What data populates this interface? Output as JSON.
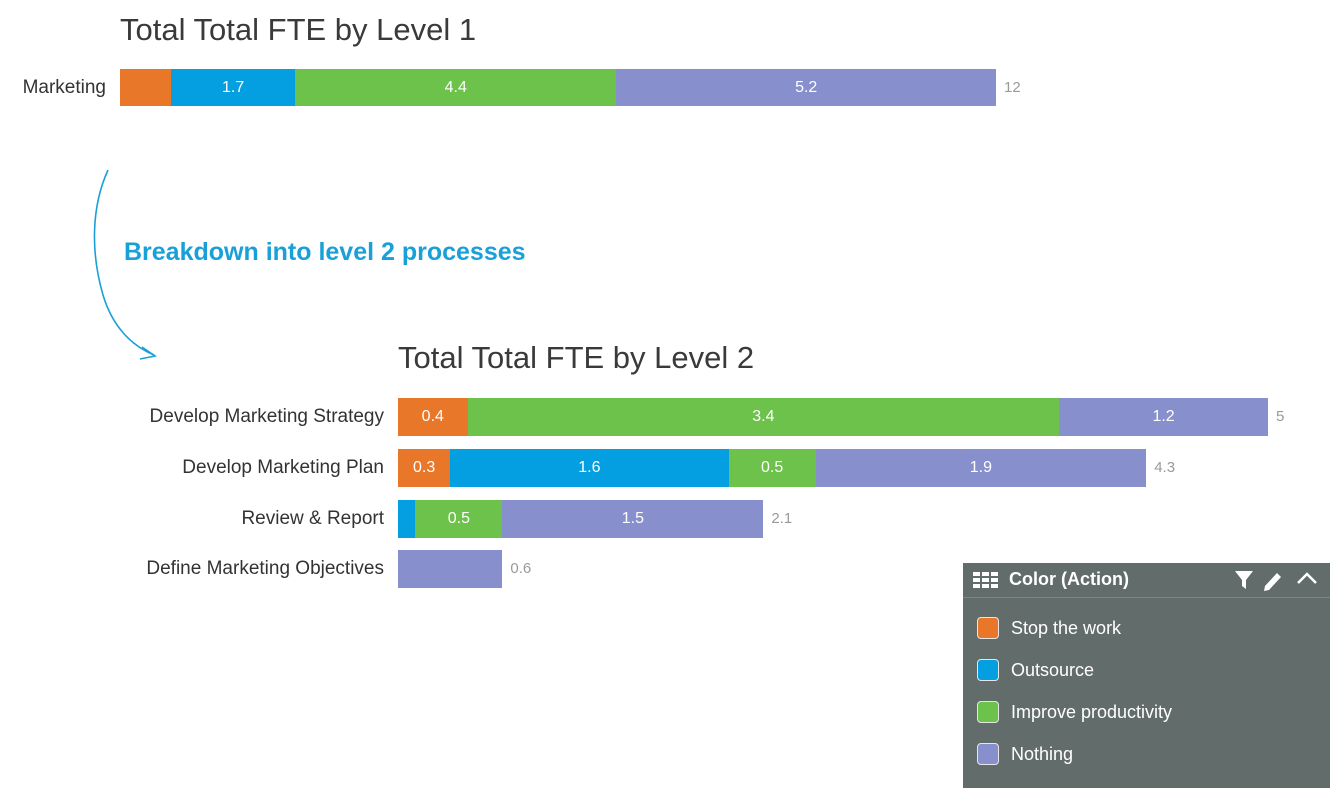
{
  "annotation": "Breakdown into level 2 processes",
  "colors": {
    "stop": "#e8772a",
    "outsource": "#039fe0",
    "improve": "#6cc24a",
    "nothing": "#878fcc"
  },
  "chart_data": [
    {
      "type": "bar",
      "orientation": "horizontal",
      "stacked": true,
      "title": "Total Total FTE by Level 1",
      "categories": [
        "Marketing"
      ],
      "series": [
        {
          "name": "Stop the work",
          "values": [
            0.7
          ]
        },
        {
          "name": "Outsource",
          "values": [
            1.7
          ]
        },
        {
          "name": "Improve productivity",
          "values": [
            4.4
          ]
        },
        {
          "name": "Nothing",
          "values": [
            5.2
          ]
        }
      ],
      "segment_labels": [
        [
          "",
          "1.7",
          "4.4",
          "5.2"
        ]
      ],
      "totals": [
        "12"
      ],
      "xlim": [
        0,
        12
      ]
    },
    {
      "type": "bar",
      "orientation": "horizontal",
      "stacked": true,
      "title": "Total Total FTE by Level 2",
      "categories": [
        "Develop Marketing Strategy",
        "Develop Marketing Plan",
        "Review & Report",
        "Define Marketing Objectives"
      ],
      "series": [
        {
          "name": "Stop the work",
          "values": [
            0.4,
            0.3,
            0,
            0
          ]
        },
        {
          "name": "Outsource",
          "values": [
            0,
            1.6,
            0.1,
            0
          ]
        },
        {
          "name": "Improve productivity",
          "values": [
            3.4,
            0.5,
            0.5,
            0
          ]
        },
        {
          "name": "Nothing",
          "values": [
            1.2,
            1.9,
            1.5,
            0.6
          ]
        }
      ],
      "segment_labels": [
        [
          "0.4",
          "",
          "3.4",
          "1.2"
        ],
        [
          "0.3",
          "1.6",
          "0.5",
          "1.9"
        ],
        [
          "",
          "",
          "0.5",
          "1.5"
        ],
        [
          "",
          "",
          "",
          ""
        ]
      ],
      "totals": [
        "5",
        "4.3",
        "2.1",
        "0.6"
      ],
      "xlim": [
        0,
        5
      ]
    }
  ],
  "legend": {
    "title": "Color (Action)",
    "items": [
      {
        "label": "Stop the work",
        "color": "#e8772a"
      },
      {
        "label": "Outsource",
        "color": "#039fe0"
      },
      {
        "label": "Improve productivity",
        "color": "#6cc24a"
      },
      {
        "label": "Nothing",
        "color": "#878fcc"
      }
    ],
    "icons": [
      "grid-icon",
      "filter-icon",
      "pencil-icon",
      "chevron-up-icon"
    ]
  }
}
